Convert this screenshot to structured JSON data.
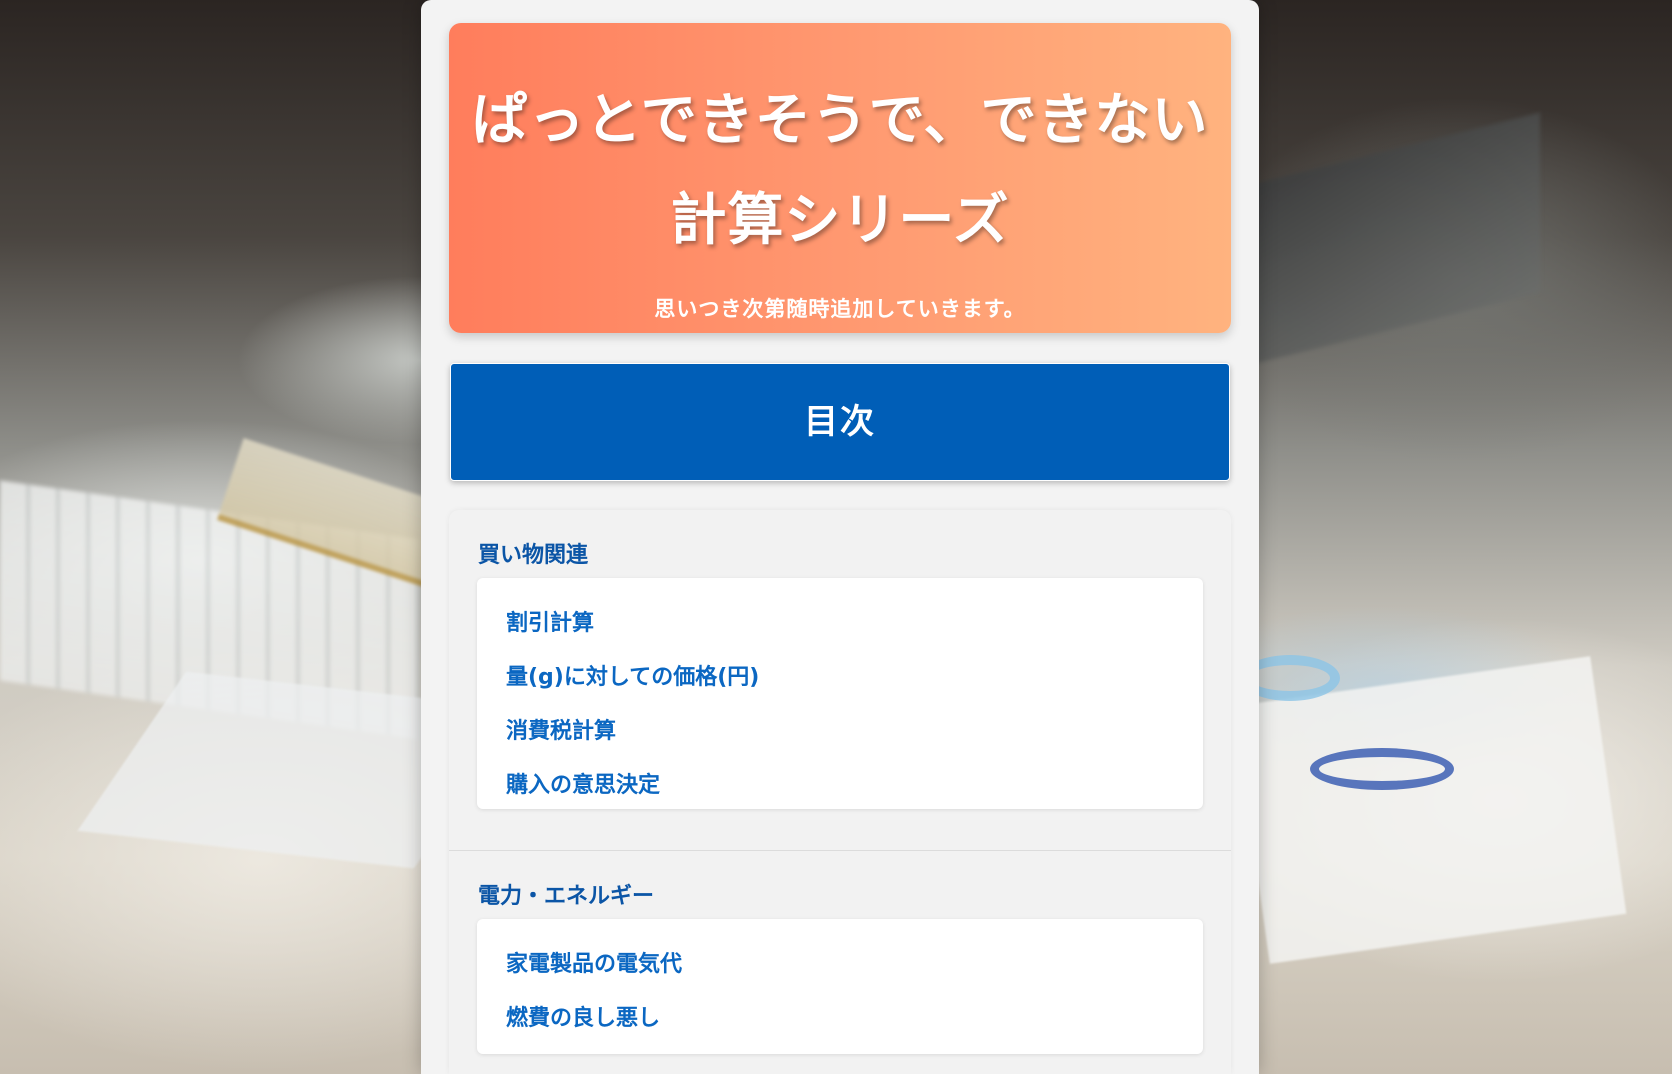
{
  "header": {
    "title_line1": "ぱっとできそうで、できない",
    "title_line2": "計算シリーズ",
    "subtitle": "思いつき次第随時追加していきます。"
  },
  "toc": {
    "label": "目次"
  },
  "categories": [
    {
      "title": "買い物関連",
      "links": [
        "割引計算",
        "量(g)に対しての価格(円)",
        "消費税計算",
        "購入の意思決定"
      ]
    },
    {
      "title": "電力・エネルギー",
      "links": [
        "家電製品の電気代",
        "燃費の良し悪し"
      ]
    }
  ],
  "colors": {
    "hero_gradient_start": "#ff7d5c",
    "hero_gradient_end": "#ffb37f",
    "toc_background": "#005eb7",
    "category_title": "#0b55a6",
    "link": "#0b67c2"
  }
}
